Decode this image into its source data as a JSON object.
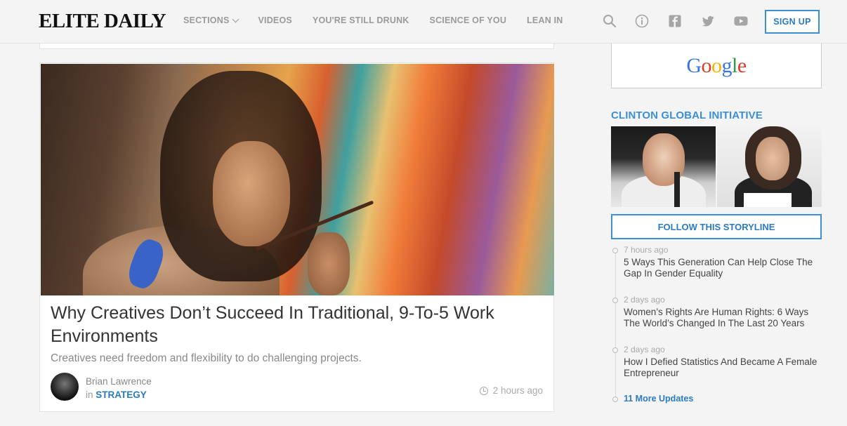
{
  "header": {
    "logo": "ELITE DAILY",
    "nav": [
      "SECTIONS",
      "VIDEOS",
      "YOU'RE STILL DRUNK",
      "SCIENCE OF YOU",
      "LEAN IN"
    ],
    "signup_label": "SIGN UP",
    "icons": [
      "search-icon",
      "info-icon",
      "facebook-icon",
      "twitter-icon",
      "youtube-icon"
    ]
  },
  "article": {
    "title": "Why Creatives Don’t Succeed In Traditional, 9-To-5 Work Environments",
    "dek": "Creatives need freedom and flexibility to do challenging projects.",
    "author": "Brian Lawrence",
    "in_label": "in",
    "category": "STRATEGY",
    "time": "2 hours ago"
  },
  "sidebar": {
    "ad_text": "Google",
    "storyline_title": "CLINTON GLOBAL INITIATIVE",
    "follow_label": "FOLLOW THIS STORYLINE",
    "updates": [
      {
        "time": "7 hours ago",
        "headline": "5 Ways This Generation Can Help Close The Gap In Gender Equality"
      },
      {
        "time": "2 days ago",
        "headline": "Women’s Rights Are Human Rights: 6 Ways The World’s Changed In The Last 20 Years"
      },
      {
        "time": "2 days ago",
        "headline": "How I Defied Statistics And Became A Female Entrepreneur"
      }
    ],
    "more_label": "11 More Updates"
  },
  "colors": {
    "accent": "#3b8fd4",
    "link": "#2b7bc0",
    "background": "#f4f4f4"
  }
}
